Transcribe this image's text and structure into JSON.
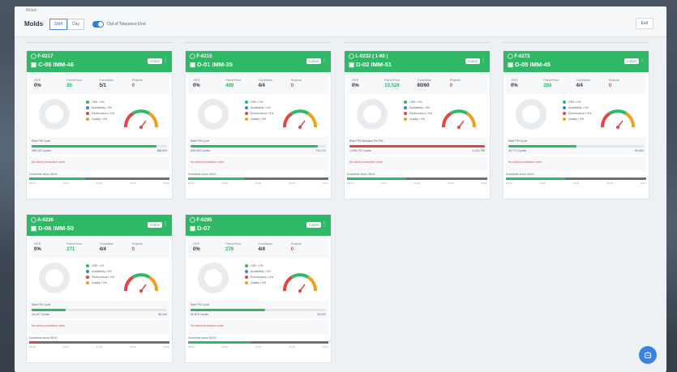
{
  "header": {
    "breadcrumb": "Molds",
    "title": "Molds",
    "seg": [
      "Shift",
      "Day"
    ],
    "seg_selected": "Shift",
    "toggle_label": "Out of Tolerance First",
    "exit_label": "Exit"
  },
  "stat_labels": {
    "oee": "OEE",
    "parts_hour": "Parts/Hour",
    "cavitation": "Cavitation",
    "rejects": "Rejects"
  },
  "legend": [
    "OEE • 0%",
    "Availability • 0%",
    "Performance • 0%",
    "Quality • 0%"
  ],
  "legend_colors": [
    "#2fb866",
    "#3a82e0",
    "#e04848",
    "#f0a020"
  ],
  "texts": {
    "run_label": "Start PM Cycle",
    "run_label_alt": "Start PM Standard Pre PM",
    "no_data": "No active production order",
    "downtime": "Downtime since 08:00",
    "active": "Active"
  },
  "cards": [
    {
      "code": "F-0217",
      "machine": "C-06 IMM-46",
      "oee": "0%",
      "ph": "86",
      "cav": "5/1",
      "rej": "0",
      "fill": 0.92,
      "red": false,
      "left_count": "356,329 Cycles",
      "right_count": "388,609",
      "down": [
        0.4,
        0.6,
        0
      ]
    },
    {
      "code": "F-0215",
      "machine": "D-01 IMM-35",
      "oee": "0%",
      "ph": "489",
      "cav": "4/4",
      "rej": "0",
      "fill": 0.94,
      "red": false,
      "left_count": "695,469 Cycles",
      "right_count": "710,372",
      "down": [
        0.4,
        0.6,
        0
      ]
    },
    {
      "code": "L-0232 ( 1-60 )",
      "machine": "D-02 IMM-51",
      "oee": "0%",
      "ph": "10,528",
      "cav": "60/60",
      "rej": "0",
      "fill": 1.0,
      "red": true,
      "left_count": "1,006,732 Cycles",
      "right_count": "1,010,785",
      "down": [
        0.42,
        0.58,
        0
      ]
    },
    {
      "code": "F-0273",
      "machine": "D-05 IMM-45",
      "oee": "0%",
      "ph": "284",
      "cav": "4/4",
      "rej": "0",
      "fill": 0.5,
      "red": false,
      "left_count": "40,774 Cycles",
      "right_count": "80,564",
      "down": [
        0.42,
        0.58,
        0
      ]
    },
    {
      "code": "A-0236",
      "machine": "D-06 IMM-50",
      "oee": "0%",
      "ph": "271",
      "cav": "4/4",
      "rej": "0",
      "fill": 0.25,
      "red": false,
      "left_count": "16,497 Cycles",
      "right_count": "86,340",
      "down": [
        0.07,
        0.38,
        0.55
      ]
    },
    {
      "code": "F-0295",
      "machine": "D-07",
      "oee": "0%",
      "ph": "279",
      "cav": "4/4",
      "rej": "0",
      "fill": 0.55,
      "red": false,
      "left_count": "50,879 Cycles",
      "right_count": "96,529",
      "down": [
        0.45,
        0.55,
        0
      ]
    }
  ],
  "ticks": [
    "08:00",
    "10:00",
    "12:00",
    "14:00",
    "16:00"
  ]
}
